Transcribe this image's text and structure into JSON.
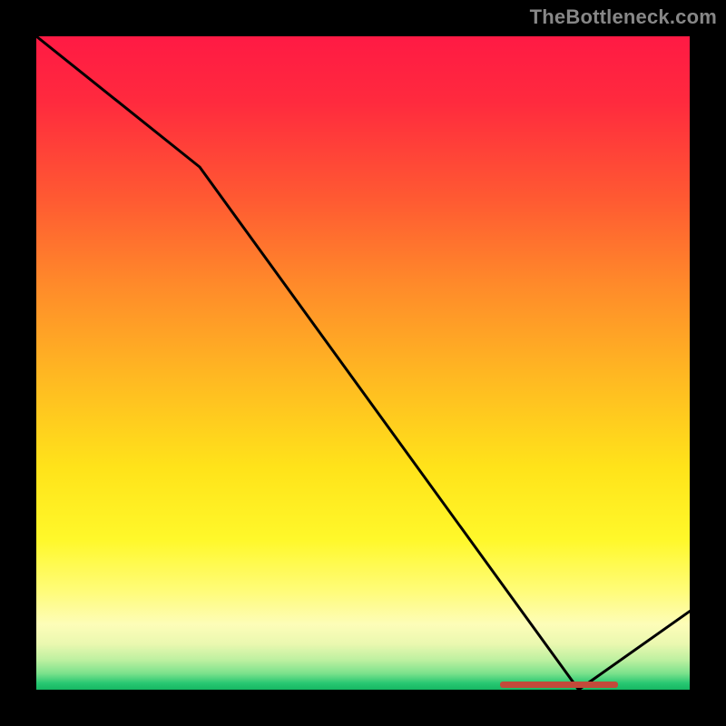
{
  "watermark": "TheBottleneck.com",
  "colors": {
    "background": "#000000",
    "watermark": "#878787",
    "line": "#000000",
    "marker": "#c24a3a"
  },
  "chart_data": {
    "type": "line",
    "title": "",
    "xlabel": "",
    "ylabel": "",
    "x": [
      0.0,
      0.25,
      0.83,
      1.0
    ],
    "values": [
      1.0,
      0.8,
      0.0,
      0.12
    ],
    "xlim": [
      0.0,
      1.0
    ],
    "ylim": [
      0.0,
      1.0
    ],
    "marker_segment_x": [
      0.71,
      0.89
    ],
    "marker_segment_y": 0.008,
    "notes": "Normalized coordinates; x left→right, y bottom→top. Background is a vertical gradient from red (top) to green (bottom)."
  }
}
